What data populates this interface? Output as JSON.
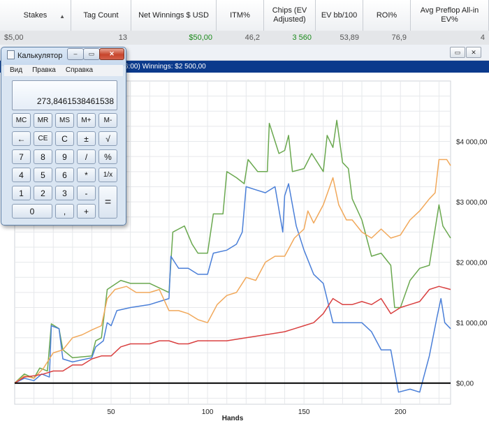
{
  "table": {
    "headers": [
      "Stakes",
      "Tag Count",
      "Net Winnings $ USD",
      "ITM%",
      "Chips (EV Adjusted)",
      "EV bb/100",
      "ROI%",
      "Avg Preflop All-in EV%"
    ],
    "row": [
      "$5,00",
      "13",
      "$50,00",
      "46,2",
      "3 560",
      "53,89",
      "76,9",
      "4"
    ],
    "sort_icon": "▲"
  },
  "graph": {
    "subtitle": "6:00)  Winnings: $2 500,00",
    "window_buttons": [
      "▭",
      "✕"
    ]
  },
  "chart_data": {
    "type": "line",
    "xlabel": "Hands",
    "ylabel": "",
    "xlim": [
      0,
      226
    ],
    "ylim": [
      -350,
      5000
    ],
    "x_ticks": [
      50,
      100,
      150,
      200
    ],
    "y_ticks": [
      0,
      1000,
      2000,
      3000,
      4000
    ],
    "y_tick_labels": [
      "$0,00",
      "$1 000,00",
      "$2 000,00",
      "$3 000,00",
      "$4 000,00"
    ],
    "grid": true,
    "colors": {
      "green": "#6aa84f",
      "blue": "#4a7fd8",
      "orange": "#f1a85a",
      "red": "#d94040",
      "zero": "#000000"
    },
    "series": [
      {
        "color": "green",
        "points": [
          [
            0,
            0
          ],
          [
            5,
            150
          ],
          [
            10,
            80
          ],
          [
            13,
            250
          ],
          [
            17,
            200
          ],
          [
            19,
            980
          ],
          [
            23,
            900
          ],
          [
            25,
            550
          ],
          [
            30,
            420
          ],
          [
            40,
            450
          ],
          [
            42,
            700
          ],
          [
            45,
            750
          ],
          [
            48,
            1550
          ],
          [
            55,
            1700
          ],
          [
            60,
            1650
          ],
          [
            70,
            1650
          ],
          [
            80,
            1500
          ],
          [
            82,
            2500
          ],
          [
            88,
            2600
          ],
          [
            92,
            2300
          ],
          [
            95,
            2150
          ],
          [
            100,
            2150
          ],
          [
            103,
            2800
          ],
          [
            108,
            2800
          ],
          [
            110,
            3500
          ],
          [
            115,
            3400
          ],
          [
            119,
            3300
          ],
          [
            121,
            3700
          ],
          [
            126,
            3500
          ],
          [
            131,
            3500
          ],
          [
            132,
            4300
          ],
          [
            137,
            3800
          ],
          [
            140,
            3850
          ],
          [
            142,
            4100
          ],
          [
            144,
            3500
          ],
          [
            150,
            3550
          ],
          [
            154,
            3800
          ],
          [
            160,
            3500
          ],
          [
            162,
            4100
          ],
          [
            165,
            3900
          ],
          [
            167,
            4350
          ],
          [
            170,
            3650
          ],
          [
            173,
            3550
          ],
          [
            175,
            3050
          ],
          [
            180,
            2700
          ],
          [
            185,
            2100
          ],
          [
            190,
            2150
          ],
          [
            195,
            1950
          ],
          [
            197,
            1250
          ],
          [
            200,
            1250
          ],
          [
            205,
            1700
          ],
          [
            210,
            1900
          ],
          [
            215,
            1950
          ],
          [
            220,
            2950
          ],
          [
            222,
            2600
          ],
          [
            226,
            2400
          ]
        ]
      },
      {
        "color": "blue",
        "points": [
          [
            0,
            0
          ],
          [
            5,
            80
          ],
          [
            10,
            40
          ],
          [
            14,
            150
          ],
          [
            18,
            100
          ],
          [
            19,
            950
          ],
          [
            23,
            900
          ],
          [
            25,
            400
          ],
          [
            30,
            350
          ],
          [
            40,
            420
          ],
          [
            42,
            600
          ],
          [
            46,
            700
          ],
          [
            48,
            1000
          ],
          [
            50,
            950
          ],
          [
            53,
            1200
          ],
          [
            60,
            1250
          ],
          [
            70,
            1300
          ],
          [
            75,
            1350
          ],
          [
            80,
            1400
          ],
          [
            81,
            2100
          ],
          [
            85,
            1900
          ],
          [
            90,
            1900
          ],
          [
            95,
            1800
          ],
          [
            100,
            1800
          ],
          [
            103,
            2150
          ],
          [
            110,
            2200
          ],
          [
            115,
            2300
          ],
          [
            118,
            2500
          ],
          [
            120,
            3250
          ],
          [
            125,
            3200
          ],
          [
            130,
            3150
          ],
          [
            135,
            3250
          ],
          [
            139,
            2500
          ],
          [
            140,
            3100
          ],
          [
            142,
            3300
          ],
          [
            146,
            2600
          ],
          [
            150,
            2200
          ],
          [
            155,
            1800
          ],
          [
            160,
            1650
          ],
          [
            165,
            1000
          ],
          [
            170,
            1000
          ],
          [
            180,
            1000
          ],
          [
            185,
            850
          ],
          [
            190,
            550
          ],
          [
            195,
            550
          ],
          [
            199,
            -150
          ],
          [
            205,
            -100
          ],
          [
            210,
            -150
          ],
          [
            215,
            450
          ],
          [
            219,
            1100
          ],
          [
            221,
            1400
          ],
          [
            223,
            1000
          ],
          [
            226,
            900
          ]
        ]
      },
      {
        "color": "orange",
        "points": [
          [
            0,
            0
          ],
          [
            5,
            120
          ],
          [
            10,
            80
          ],
          [
            15,
            250
          ],
          [
            20,
            500
          ],
          [
            25,
            550
          ],
          [
            30,
            750
          ],
          [
            35,
            800
          ],
          [
            40,
            880
          ],
          [
            45,
            950
          ],
          [
            48,
            1400
          ],
          [
            52,
            1550
          ],
          [
            58,
            1600
          ],
          [
            63,
            1500
          ],
          [
            70,
            1500
          ],
          [
            75,
            1550
          ],
          [
            80,
            1200
          ],
          [
            85,
            1200
          ],
          [
            90,
            1150
          ],
          [
            95,
            1050
          ],
          [
            100,
            1000
          ],
          [
            105,
            1300
          ],
          [
            110,
            1450
          ],
          [
            115,
            1500
          ],
          [
            120,
            1750
          ],
          [
            125,
            1700
          ],
          [
            130,
            2000
          ],
          [
            135,
            2100
          ],
          [
            140,
            2100
          ],
          [
            145,
            2400
          ],
          [
            150,
            2550
          ],
          [
            152,
            2850
          ],
          [
            155,
            2650
          ],
          [
            160,
            2950
          ],
          [
            165,
            3400
          ],
          [
            168,
            2950
          ],
          [
            172,
            2700
          ],
          [
            175,
            2700
          ],
          [
            180,
            2500
          ],
          [
            185,
            2400
          ],
          [
            190,
            2550
          ],
          [
            195,
            2400
          ],
          [
            200,
            2450
          ],
          [
            205,
            2700
          ],
          [
            210,
            2850
          ],
          [
            215,
            3050
          ],
          [
            218,
            3150
          ],
          [
            220,
            3700
          ],
          [
            224,
            3700
          ],
          [
            226,
            3600
          ]
        ]
      },
      {
        "color": "red",
        "points": [
          [
            0,
            0
          ],
          [
            5,
            100
          ],
          [
            10,
            120
          ],
          [
            15,
            150
          ],
          [
            20,
            200
          ],
          [
            25,
            200
          ],
          [
            30,
            300
          ],
          [
            35,
            300
          ],
          [
            40,
            400
          ],
          [
            45,
            450
          ],
          [
            50,
            450
          ],
          [
            55,
            600
          ],
          [
            60,
            650
          ],
          [
            70,
            650
          ],
          [
            75,
            700
          ],
          [
            80,
            700
          ],
          [
            85,
            650
          ],
          [
            90,
            650
          ],
          [
            95,
            700
          ],
          [
            100,
            700
          ],
          [
            110,
            700
          ],
          [
            120,
            750
          ],
          [
            130,
            800
          ],
          [
            140,
            850
          ],
          [
            145,
            900
          ],
          [
            150,
            950
          ],
          [
            155,
            1000
          ],
          [
            160,
            1150
          ],
          [
            165,
            1400
          ],
          [
            170,
            1300
          ],
          [
            175,
            1300
          ],
          [
            180,
            1350
          ],
          [
            185,
            1300
          ],
          [
            190,
            1400
          ],
          [
            195,
            1150
          ],
          [
            200,
            1250
          ],
          [
            205,
            1300
          ],
          [
            210,
            1350
          ],
          [
            215,
            1550
          ],
          [
            220,
            1600
          ],
          [
            226,
            1550
          ]
        ]
      }
    ]
  },
  "calculator": {
    "title": "Калькулятор",
    "window_buttons": [
      "–",
      "▭",
      "✕"
    ],
    "menu": [
      "Вид",
      "Правка",
      "Справка"
    ],
    "display": "273,8461538461538",
    "rows": [
      [
        "MC",
        "MR",
        "MS",
        "M+",
        "M-"
      ],
      [
        "←",
        "CE",
        "C",
        "±",
        "√"
      ],
      [
        "7",
        "8",
        "9",
        "/",
        "%"
      ],
      [
        "4",
        "5",
        "6",
        "*",
        "1/x"
      ],
      [
        "1",
        "2",
        "3",
        "-"
      ],
      [
        "0",
        ",",
        "+"
      ]
    ],
    "equals": "="
  }
}
